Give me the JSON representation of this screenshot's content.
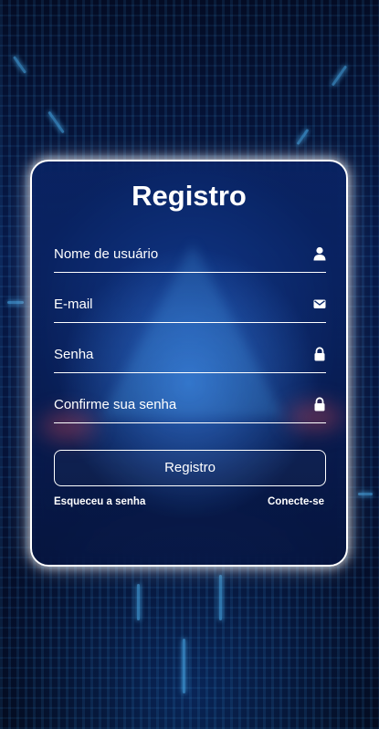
{
  "form": {
    "title": "Registro",
    "fields": [
      {
        "label": "Nome de usuário",
        "icon": "user-icon"
      },
      {
        "label": "E-mail",
        "icon": "envelope-icon"
      },
      {
        "label": "Senha",
        "icon": "lock-icon"
      },
      {
        "label": "Confirme sua senha",
        "icon": "lock-icon"
      }
    ],
    "submit_label": "Registro",
    "forgot_label": "Esqueceu a senha",
    "login_label": "Conecte-se"
  },
  "colors": {
    "accent": "#ffffff",
    "background": "#071a4a"
  }
}
